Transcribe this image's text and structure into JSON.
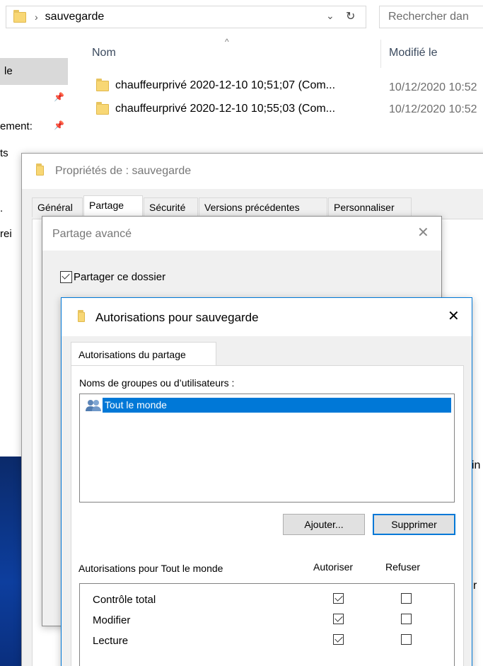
{
  "explorer": {
    "path_segment": "sauvegarde",
    "search_placeholder": "Rechercher dan",
    "col_name": "Nom",
    "col_modified": "Modifié le",
    "files": [
      {
        "name": "chauffeurprivé 2020-12-10 10;51;07 (Com...",
        "modified": "10/12/2020 10:52"
      },
      {
        "name": "chauffeurprivé 2020-12-10 10;55;03 (Com...",
        "modified": "10/12/2020 10:52"
      }
    ],
    "nav_items": [
      "le",
      "ement:",
      "ts",
      ".",
      "rei"
    ],
    "right_fragments": [
      "in",
      "r"
    ]
  },
  "properties": {
    "title": "Propriétés de : sauvegarde",
    "tabs": [
      "Général",
      "Partage",
      "Sécurité",
      "Versions précédentes",
      "Personnaliser"
    ]
  },
  "advanced": {
    "title": "Partage avancé",
    "share_checkbox_label": "Partager ce dossier"
  },
  "perms": {
    "title": "Autorisations pour sauvegarde",
    "close_glyph": "✕",
    "tab": "Autorisations du partage",
    "groups_label": "Noms de groupes ou d’utilisateurs :",
    "users": [
      "Tout le monde"
    ],
    "add_label": "Ajouter...",
    "remove_label": "Supprimer",
    "perm_header": "Autorisations pour Tout le monde",
    "allow_header": "Autoriser",
    "deny_header": "Refuser",
    "rows": [
      {
        "name": "Contrôle total",
        "allow": true,
        "deny": false
      },
      {
        "name": "Modifier",
        "allow": true,
        "deny": false
      },
      {
        "name": "Lecture",
        "allow": true,
        "deny": false
      }
    ]
  },
  "colors": {
    "accent": "#0078d7",
    "selection": "#0078d7",
    "folder": "#f8d775"
  }
}
